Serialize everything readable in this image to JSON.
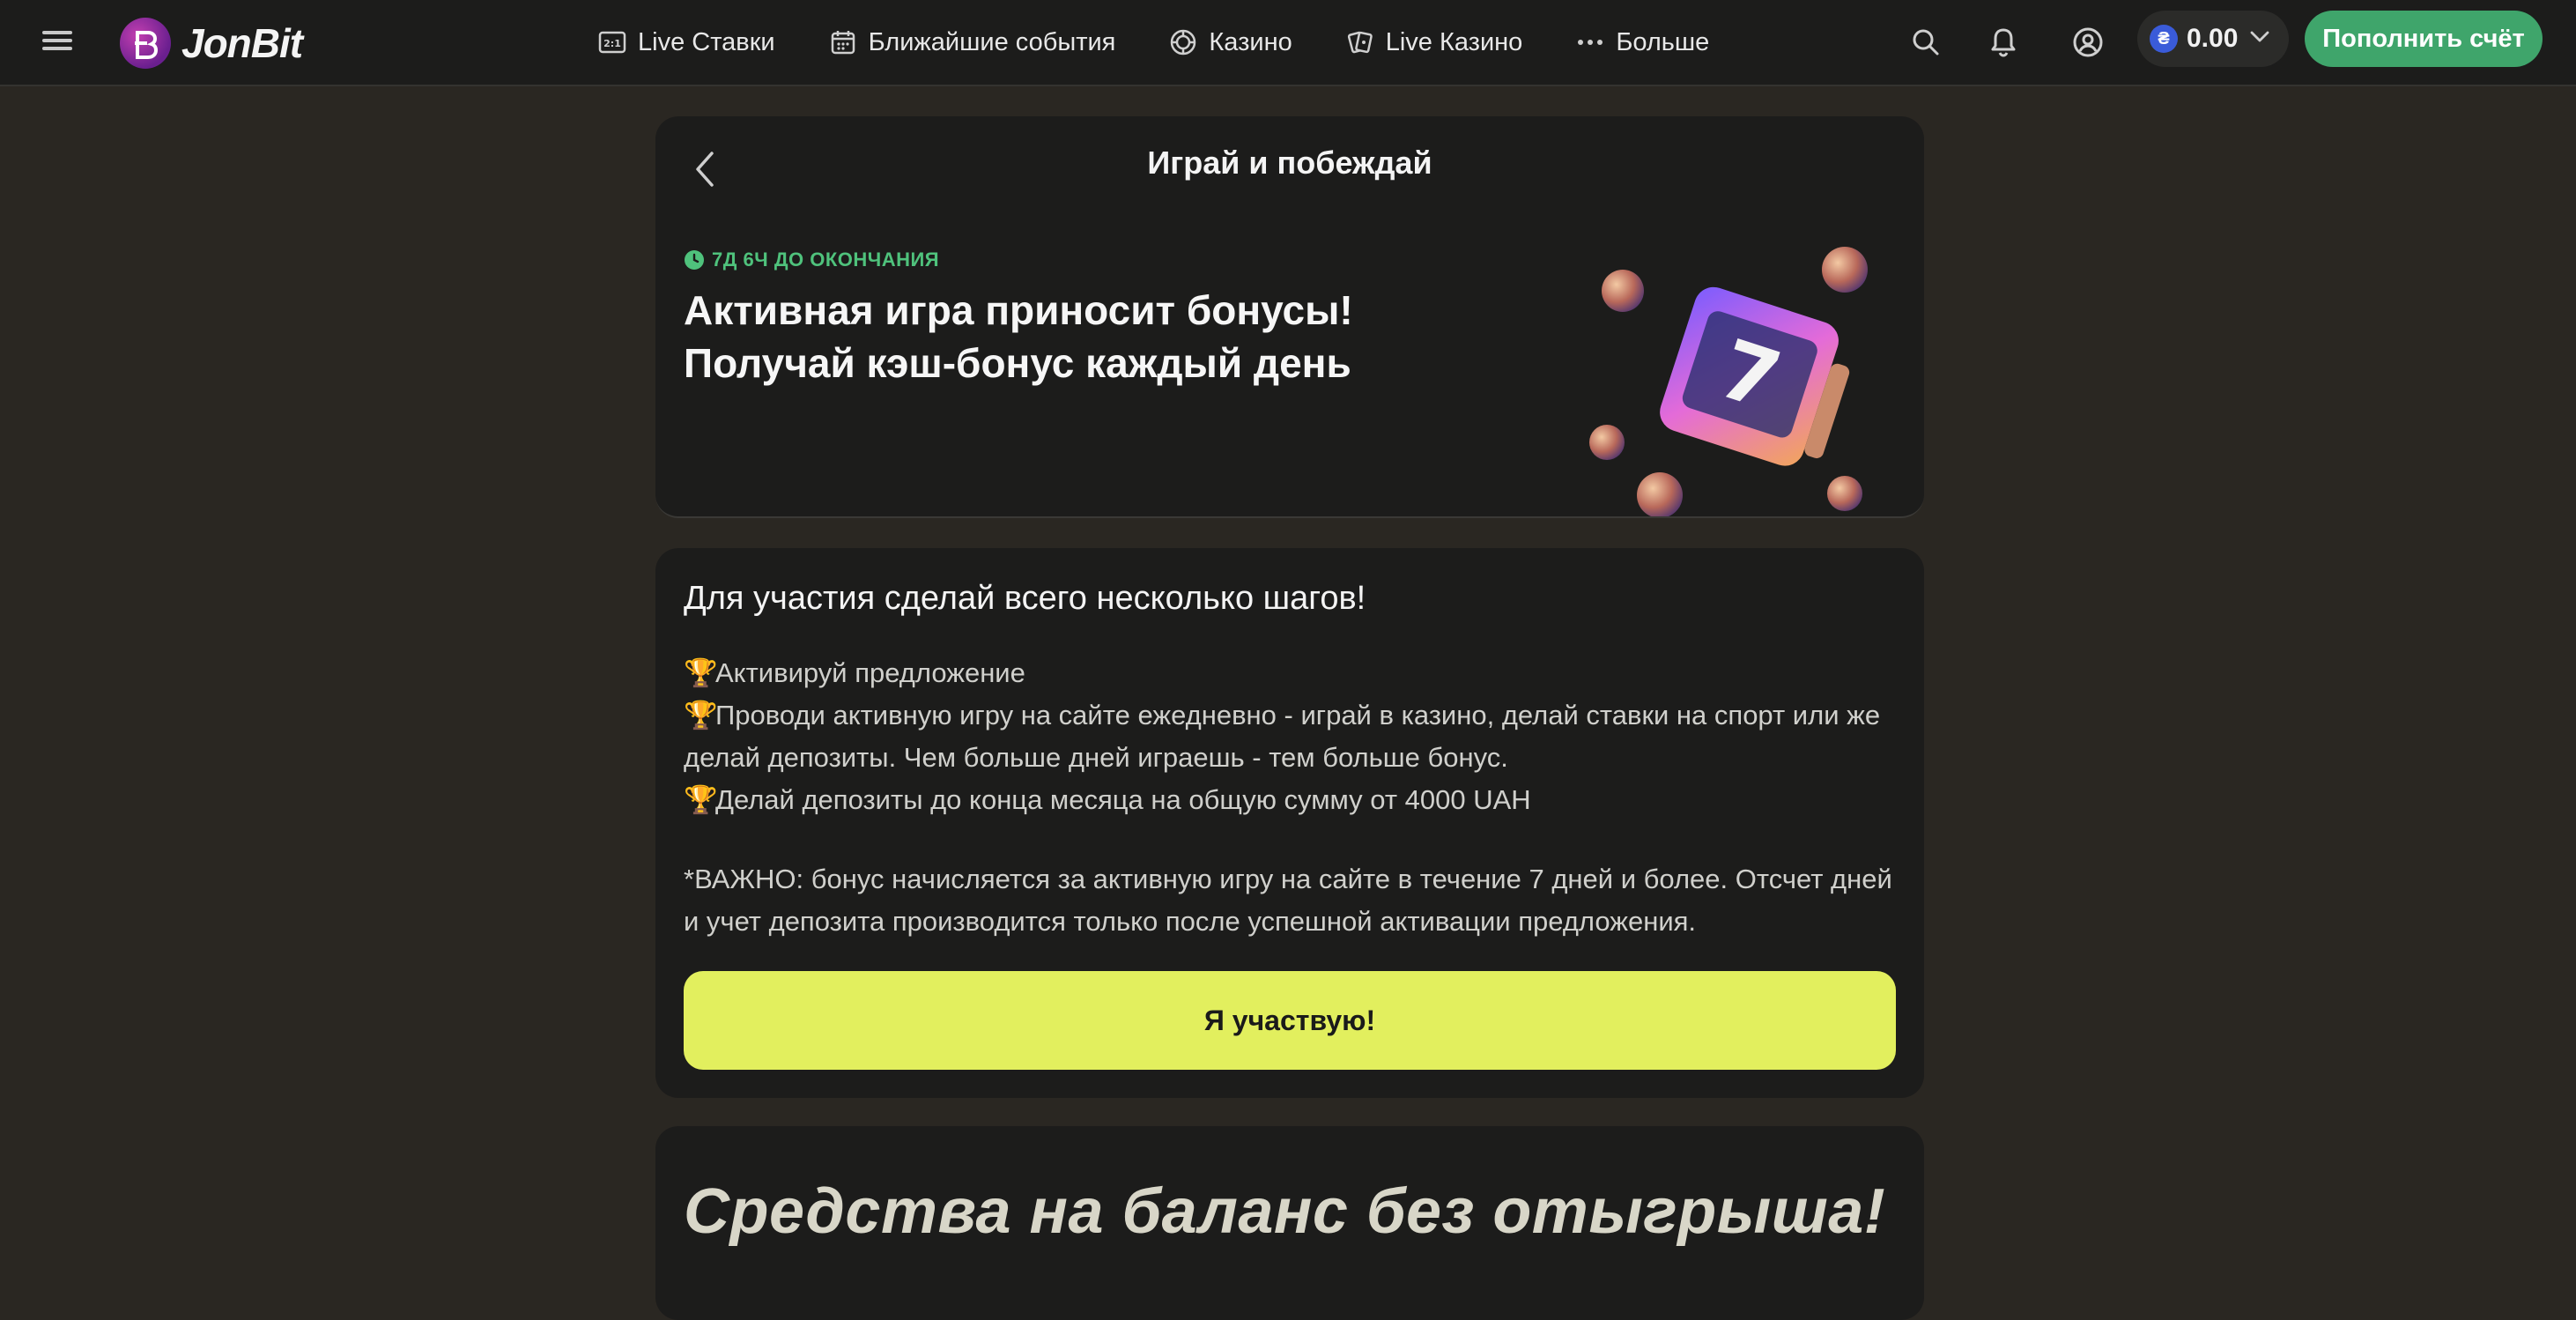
{
  "brand": {
    "name": "JonBit"
  },
  "nav": [
    {
      "label": "Live Ставки",
      "icon": "live-bets-icon"
    },
    {
      "label": "Ближайшие события",
      "icon": "calendar-icon"
    },
    {
      "label": "Казино",
      "icon": "casino-chip-icon"
    },
    {
      "label": "Live Казино",
      "icon": "cards-icon"
    },
    {
      "label": "Больше",
      "icon": "more-dots-icon"
    }
  ],
  "header": {
    "balance": "0.00",
    "currency_symbol": "₴",
    "deposit_label": "Пополнить счёт"
  },
  "promo": {
    "page_title": "Играй и побеждай",
    "countdown": "7Д 6Ч ДО ОКОНЧАНИЯ",
    "headline_line1": "Активная игра приносит бонусы!",
    "headline_line2": "Получай кэш-бонус каждый день"
  },
  "steps_card": {
    "heading": "Для участия сделай всего несколько шагов!",
    "steps": [
      "Активируй предложение",
      "Проводи активную игру на сайте ежедневно - играй в казино, делай ставки на спорт или же делай депозиты. Чем больше дней играешь - тем больше бонус.",
      "Делай депозиты до конца месяца на общую сумму от 4000 UAH"
    ],
    "note": "*ВАЖНО: бонус начисляется за активную игру на сайте в течение 7 дней и более. Отсчет дней и учет депозита производится только после успешной активации предложения.",
    "cta": "Я участвую!"
  },
  "banner": {
    "text": "Средства на баланс без отыгрыша!"
  },
  "colors": {
    "accent_green": "#3fa56b",
    "cta_yellow": "#e2ef5e",
    "countdown_green": "#4fc27c",
    "card_bg": "#1c1c1b",
    "page_bg": "#2a2722"
  }
}
